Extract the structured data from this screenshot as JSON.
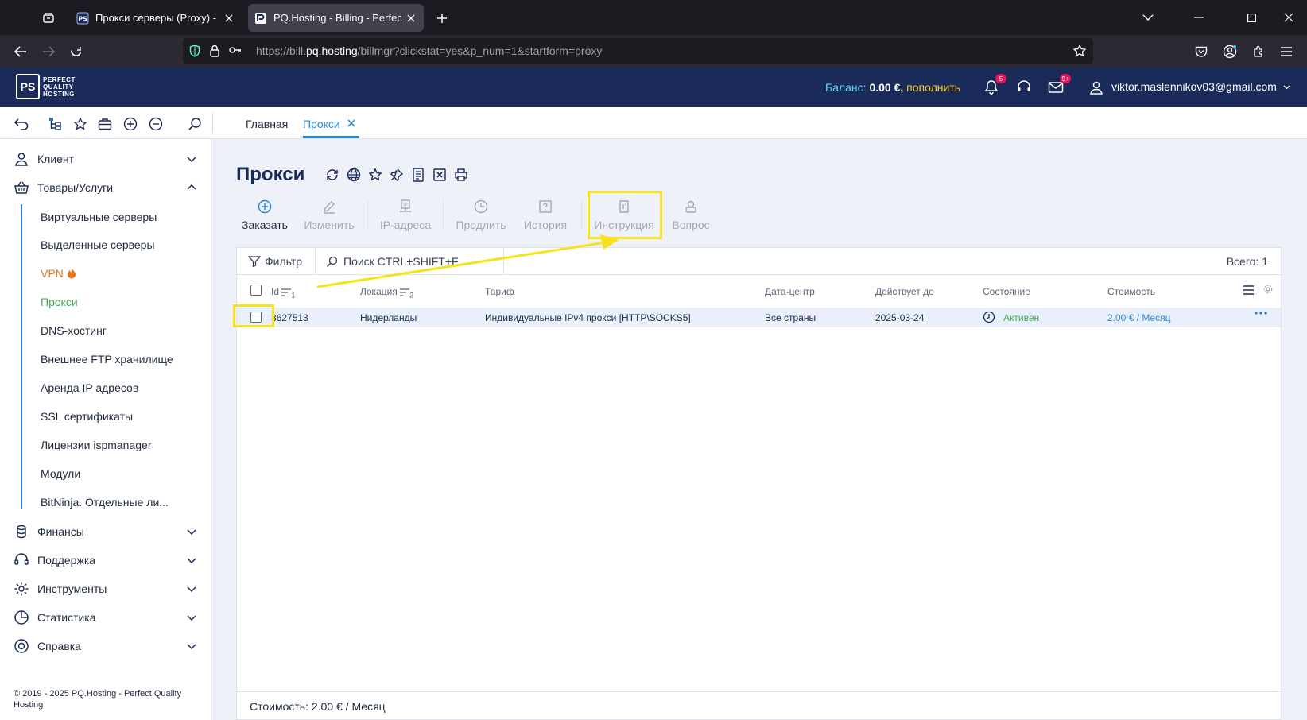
{
  "browser": {
    "tabs": [
      {
        "title": "Прокси серверы (Proxy) - Купи",
        "active": false
      },
      {
        "title": "PQ.Hosting - Billing - Perfect Qu",
        "active": true
      }
    ],
    "url": {
      "prefix": "https://bill.",
      "host": "pq.hosting",
      "path": "/billmgr?clickstat=yes&p_num=1&startform=proxy"
    }
  },
  "header": {
    "logo_mark": "PS",
    "logo_text": [
      "PERFECT",
      "QUALITY",
      "HOSTING"
    ],
    "balance_label": "Баланс:",
    "balance_amount": "0.00 €,",
    "topup_label": "пополнить",
    "notifications_badge": "5",
    "messages_badge": "9+",
    "user_email": "viktor.maslennikov03@gmail.com"
  },
  "breadcrumbs": {
    "home": "Главная",
    "current": "Прокси"
  },
  "sidebar": {
    "sections": [
      {
        "label": "Клиент",
        "icon": "client-icon",
        "expanded": false
      },
      {
        "label": "Товары/Услуги",
        "icon": "basket-icon",
        "expanded": true
      },
      {
        "label": "Финансы",
        "icon": "coins-icon",
        "expanded": false
      },
      {
        "label": "Поддержка",
        "icon": "headset-icon",
        "expanded": false
      },
      {
        "label": "Инструменты",
        "icon": "gear-icon",
        "expanded": false
      },
      {
        "label": "Статистика",
        "icon": "chart-icon",
        "expanded": false
      },
      {
        "label": "Справка",
        "icon": "lifebuoy-icon",
        "expanded": false
      }
    ],
    "products": [
      "Виртуальные серверы",
      "Выделенные серверы",
      "VPN",
      "Прокси",
      "DNS-хостинг",
      "Внешнее FTP хранилище",
      "Аренда IP адресов",
      "SSL сертификаты",
      "Лицензии ispmanager",
      "Модули",
      "BitNinja. Отдельные ли..."
    ],
    "active_product": "Прокси",
    "copyright": "© 2019 - 2025 PQ.Hosting - Perfect Quality Hosting"
  },
  "page": {
    "title": "Прокси",
    "actions": [
      {
        "label": "Заказать",
        "icon": "plus-circle-icon",
        "enabled": true
      },
      {
        "label": "Изменить",
        "icon": "pencil-icon",
        "enabled": false
      },
      {
        "label": "IP-адреса",
        "icon": "ip-icon",
        "enabled": false
      },
      {
        "label": "Продлить",
        "icon": "clock-icon",
        "enabled": false
      },
      {
        "label": "История",
        "icon": "history-icon",
        "enabled": false
      },
      {
        "label": "Инструкция",
        "icon": "instruction-icon",
        "enabled": false
      },
      {
        "label": "Вопрос",
        "icon": "question-icon",
        "enabled": false
      }
    ]
  },
  "table": {
    "filter_label": "Фильтр",
    "search_placeholder": "Поиск CTRL+SHIFT+F",
    "total": "Всего: 1",
    "columns": {
      "id": "Id",
      "id_sort": "1",
      "location": "Локация",
      "location_sort": "2",
      "tariff": "Тариф",
      "datacenter": "Дата-центр",
      "valid_until": "Действует до",
      "status": "Состояние",
      "cost": "Стоимость"
    },
    "rows": [
      {
        "id": "3627513",
        "location": "Нидерланды",
        "tariff": "Индивидуальные IPv4 прокси [HTTP\\SOCKS5]",
        "datacenter": "Все страны",
        "valid_until": "2025-03-24",
        "status": "Активен",
        "cost": "2.00 € / Месяц"
      }
    ],
    "footer": "Стоимость: 2.00 € / Месяц"
  },
  "colors": {
    "header_bg": "#1a2b59",
    "accent": "#2a8cd6",
    "active_green": "#3eae52",
    "vpn_orange": "#e0751e",
    "highlight_yellow": "#f5e31b"
  }
}
